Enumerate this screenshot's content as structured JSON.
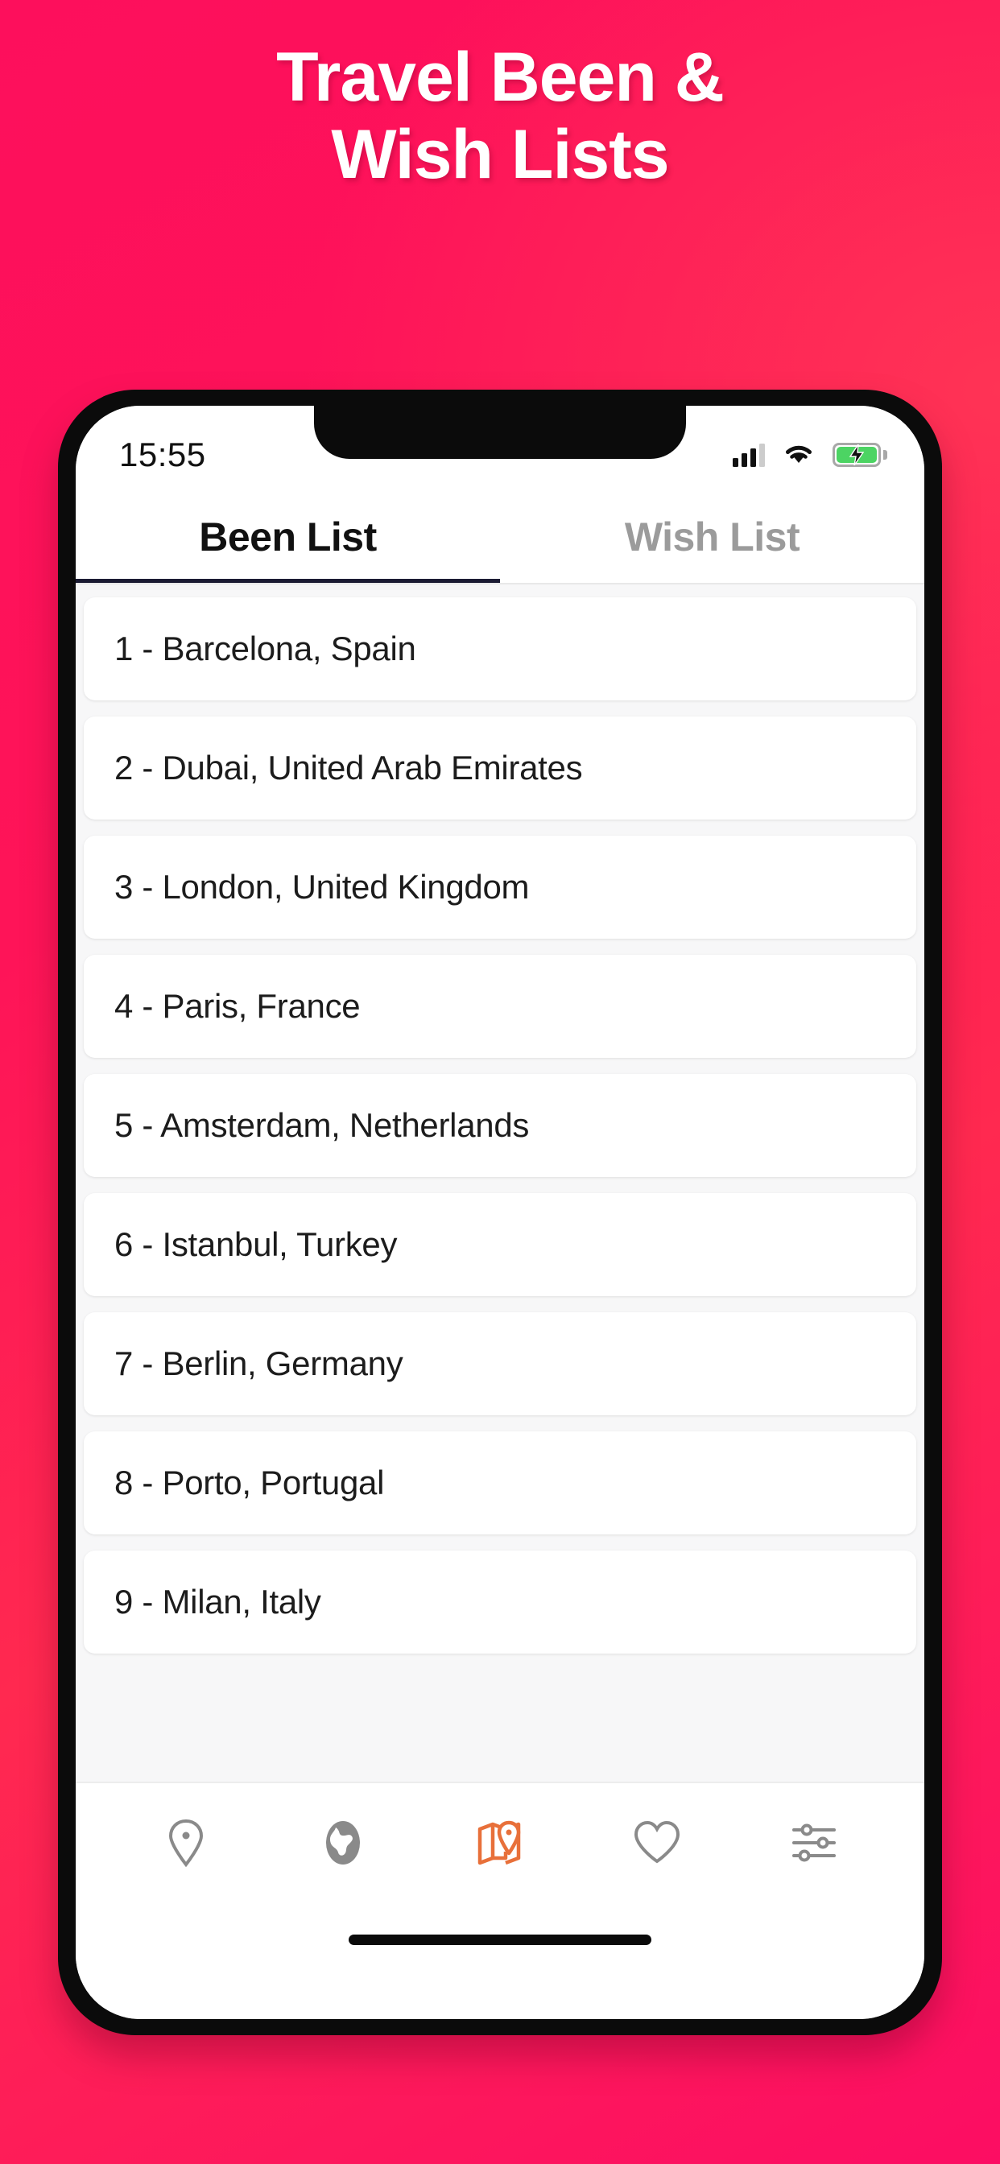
{
  "background": {
    "gradient_start": "#FD0F5C",
    "gradient_end": "#FF2950"
  },
  "hero": {
    "line1": "Travel Been &",
    "line2": "Wish Lists",
    "color": "#FFFFFF"
  },
  "phone": {
    "status_bar": {
      "time": "15:55",
      "signal_icon": "cellular-signal-icon",
      "signal_bars_filled": 3,
      "signal_bars_total": 4,
      "wifi_icon": "wifi-icon",
      "battery_icon": "battery-charging-icon",
      "battery_color": "#4CD463",
      "battery_charging": true
    },
    "tabs": [
      {
        "label": "Been List",
        "active": true
      },
      {
        "label": "Wish List",
        "active": false
      }
    ],
    "tab_indicator_color": "#1B1B33",
    "list": {
      "items": [
        {
          "label": "1 - Barcelona, Spain"
        },
        {
          "label": "2 - Dubai, United Arab Emirates"
        },
        {
          "label": "3 - London, United Kingdom"
        },
        {
          "label": "4 - Paris, France"
        },
        {
          "label": "5 - Amsterdam, Netherlands"
        },
        {
          "label": "6 - Istanbul, Turkey"
        },
        {
          "label": "7 - Berlin, Germany"
        },
        {
          "label": "8 - Porto, Portugal"
        },
        {
          "label": "9 - Milan, Italy"
        }
      ]
    },
    "bottom_nav": {
      "active_color": "#E8703A",
      "inactive_color": "#8A8A8A",
      "items": [
        {
          "icon": "location-pin-icon",
          "active": false
        },
        {
          "icon": "globe-icon",
          "active": false
        },
        {
          "icon": "map-icon",
          "active": true
        },
        {
          "icon": "heart-icon",
          "active": false
        },
        {
          "icon": "sliders-icon",
          "active": false
        }
      ]
    },
    "home_indicator": "home-indicator-bar"
  }
}
